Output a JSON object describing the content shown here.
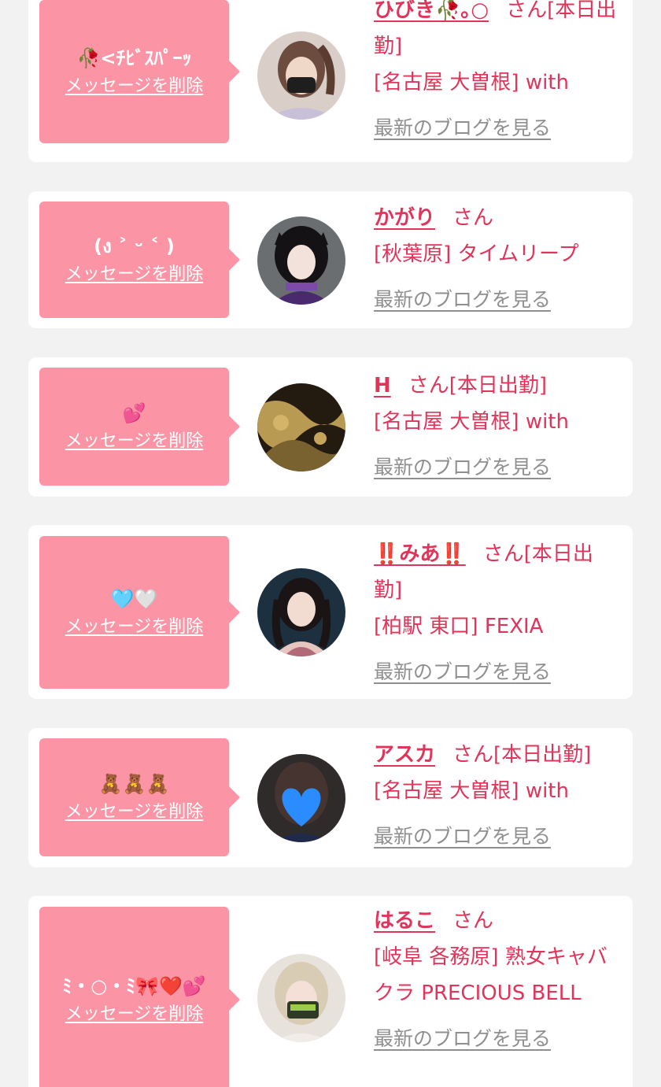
{
  "rows": [
    {
      "message": "🥀<ﾁﾋﾞｽﾊﾟｰｯ",
      "delete_label": "メッセージを削除",
      "name": "ひびき🥀｡○",
      "suffix": "さん[本日出勤]",
      "shop": "[名古屋 大曽根] with",
      "blog_label": "最新のブログを見る"
    },
    {
      "message": "(ง ˃ ᵕ ˂ )",
      "delete_label": "メッセージを削除",
      "name": "かがり",
      "suffix": "さん",
      "shop": "[秋葉原] タイムリープ",
      "blog_label": "最新のブログを見る"
    },
    {
      "message": "💕",
      "delete_label": "メッセージを削除",
      "name": "H",
      "suffix": "さん[本日出勤]",
      "shop": "[名古屋 大曽根] with",
      "blog_label": "最新のブログを見る"
    },
    {
      "message": "🩵🤍",
      "delete_label": "メッセージを削除",
      "name": "‼️みあ‼️",
      "suffix": "さん[本日出勤]",
      "shop": "[柏駅 東口] FEXIA",
      "blog_label": "最新のブログを見る"
    },
    {
      "message": "🧸🧸🧸",
      "delete_label": "メッセージを削除",
      "name": "アスカ",
      "suffix": "さん[本日出勤]",
      "shop": "[名古屋 大曽根] with",
      "blog_label": "最新のブログを見る"
    },
    {
      "message": "ﾐ・○・ﾐ🎀❤️💕",
      "delete_label": "メッセージを削除",
      "name": "はるこ",
      "suffix": "さん",
      "shop": "[岐阜 各務原]  熟女キャバクラ PRECIOUS BELL",
      "blog_label": "最新のブログを見る"
    }
  ],
  "colors": {
    "background": "#f2f2f2",
    "card": "#ffffff",
    "bubble": "#fb94a5",
    "accent": "#e0345a",
    "link_gray": "#8f8f8f"
  }
}
